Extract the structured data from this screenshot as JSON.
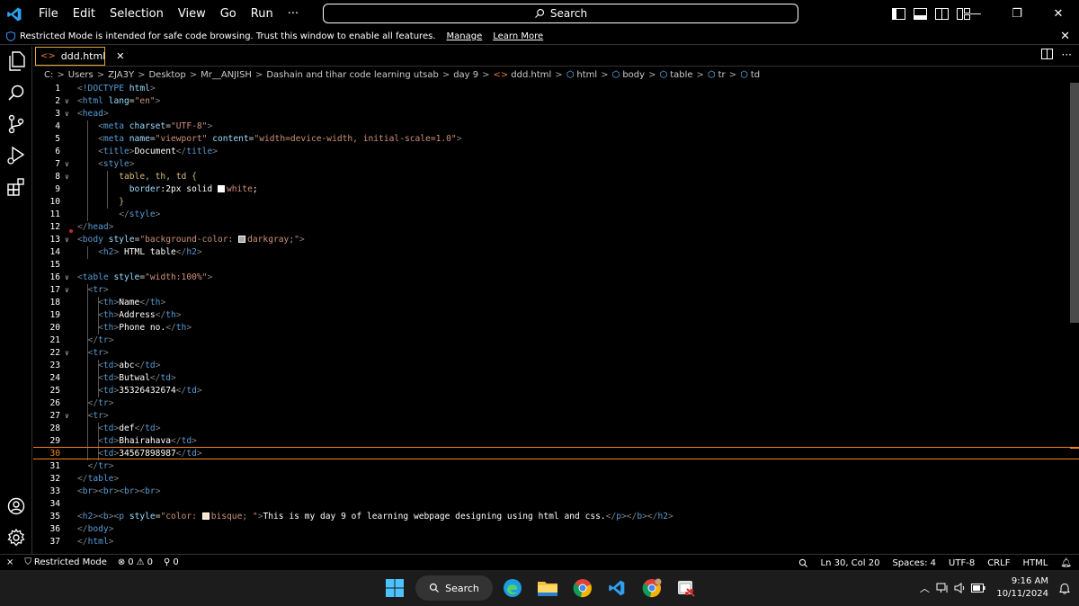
{
  "menu": [
    "File",
    "Edit",
    "Selection",
    "View",
    "Go",
    "Run",
    "···"
  ],
  "search": {
    "label": "Search"
  },
  "banner": {
    "text": "Restricted Mode is intended for safe code browsing. Trust this window to enable all features.",
    "manage": "Manage",
    "learn_more": "Learn More"
  },
  "tab": {
    "filename": "ddd.html"
  },
  "breadcrumb": [
    "C:",
    "Users",
    "ZJA3Y",
    "Desktop",
    "Mr__ANJISH",
    "Dashain and tihar code learning utsab",
    "day 9",
    "ddd.html",
    "html",
    "body",
    "table",
    "tr",
    "td"
  ],
  "editor": {
    "current_line": 30,
    "lines": [
      "1",
      "2",
      "3",
      "4",
      "5",
      "6",
      "7",
      "8",
      "9",
      "10",
      "11",
      "12",
      "13",
      "14",
      "15",
      "16",
      "17",
      "18",
      "19",
      "20",
      "21",
      "22",
      "23",
      "24",
      "25",
      "26",
      "27",
      "28",
      "29",
      "30",
      "31",
      "32",
      "33",
      "34",
      "35",
      "36",
      "37"
    ],
    "code": {
      "doctype": "!DOCTYPE",
      "html": "html",
      "lang": "lang",
      "lang_val": "\"en\"",
      "head": "head",
      "meta": "meta",
      "charset": "charset",
      "charset_val": "\"UTF-8\"",
      "name": "name",
      "name_val": "\"viewport\"",
      "content": "content",
      "content_val": "\"width=device-width, initial-scale=1.0\"",
      "title": "title",
      "title_text": "Document",
      "style": "style",
      "selector": "table, th, td {",
      "border_prop": "border",
      "border_val": ":2px solid ",
      "border_color": "white",
      "close_brace": "}",
      "body": "body",
      "body_style_attr": "style",
      "body_style_pre": "\"background-color: ",
      "body_style_color": "darkgray",
      "body_style_post": ";\"",
      "h2": "h2",
      "h2_text": " HTML table",
      "table": "table",
      "table_style_val": "\"width:100%\"",
      "tr": "tr",
      "th": "th",
      "td": "td",
      "th1": "Name",
      "th2": "Address",
      "th3": "Phone no.",
      "td1": "abc",
      "td2": "Butwal",
      "td3": "35326432674",
      "td4": "def",
      "td5": "Bhairahava",
      "td6": "34567898987",
      "br": "br",
      "b": "b",
      "p": "p",
      "p_style_pre": "\"color: ",
      "p_style_color": "bisque",
      "p_style_post": "; \"",
      "p_text": "This is my day 9 of learning webpage designing using html and css."
    }
  },
  "status": {
    "restricted": "Restricted Mode",
    "errors": "0",
    "warnings": "0",
    "ports": "0",
    "position": "Ln 30, Col 20",
    "spaces": "Spaces: 4",
    "encoding": "UTF-8",
    "eol": "CRLF",
    "language": "HTML"
  },
  "taskbar": {
    "search": "Search",
    "time": "9:16 AM",
    "date": "10/11/2024"
  },
  "colors": {
    "accent_orange": "#f38518",
    "tag_blue": "#569cd6",
    "attr_lightblue": "#9cdcfe",
    "string_orange": "#ce9178",
    "swatch_white": "#ffffff",
    "swatch_darkgray": "#a9a9a9",
    "swatch_bisque": "#ffe4c4"
  }
}
